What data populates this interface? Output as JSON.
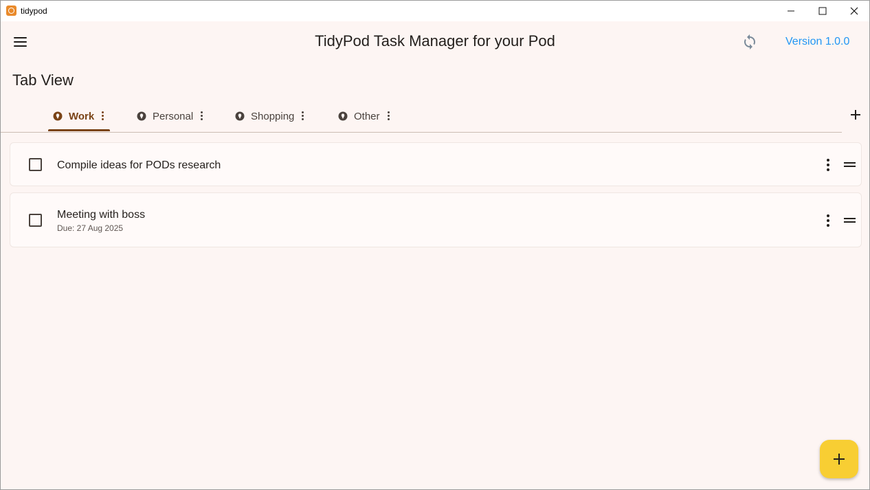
{
  "window": {
    "title": "tidypod",
    "app_icon": "tidypod-logo-icon",
    "controls": [
      "minimize-icon",
      "maximize-icon",
      "close-icon"
    ]
  },
  "appbar": {
    "menu_icon": "hamburger-menu-icon",
    "title": "TidyPod Task Manager for your Pod",
    "sync_icon": "sync-icon",
    "version": "Version 1.0.0"
  },
  "section": {
    "title": "Tab View"
  },
  "tabs": {
    "items": [
      {
        "label": "Work",
        "active": true
      },
      {
        "label": "Personal",
        "active": false
      },
      {
        "label": "Shopping",
        "active": false
      },
      {
        "label": "Other",
        "active": false
      }
    ],
    "add_icon": "add-icon"
  },
  "tasks": [
    {
      "title": "Compile ideas for PODs research",
      "due": "",
      "checked": false
    },
    {
      "title": "Meeting with boss",
      "due": "Due: 27 Aug 2025",
      "checked": false
    }
  ],
  "fab": {
    "icon": "add-icon"
  },
  "colors": {
    "background": "#fdf5f3",
    "accent": "#7a4316",
    "link": "#2196f3",
    "fab": "#f8ce33"
  }
}
